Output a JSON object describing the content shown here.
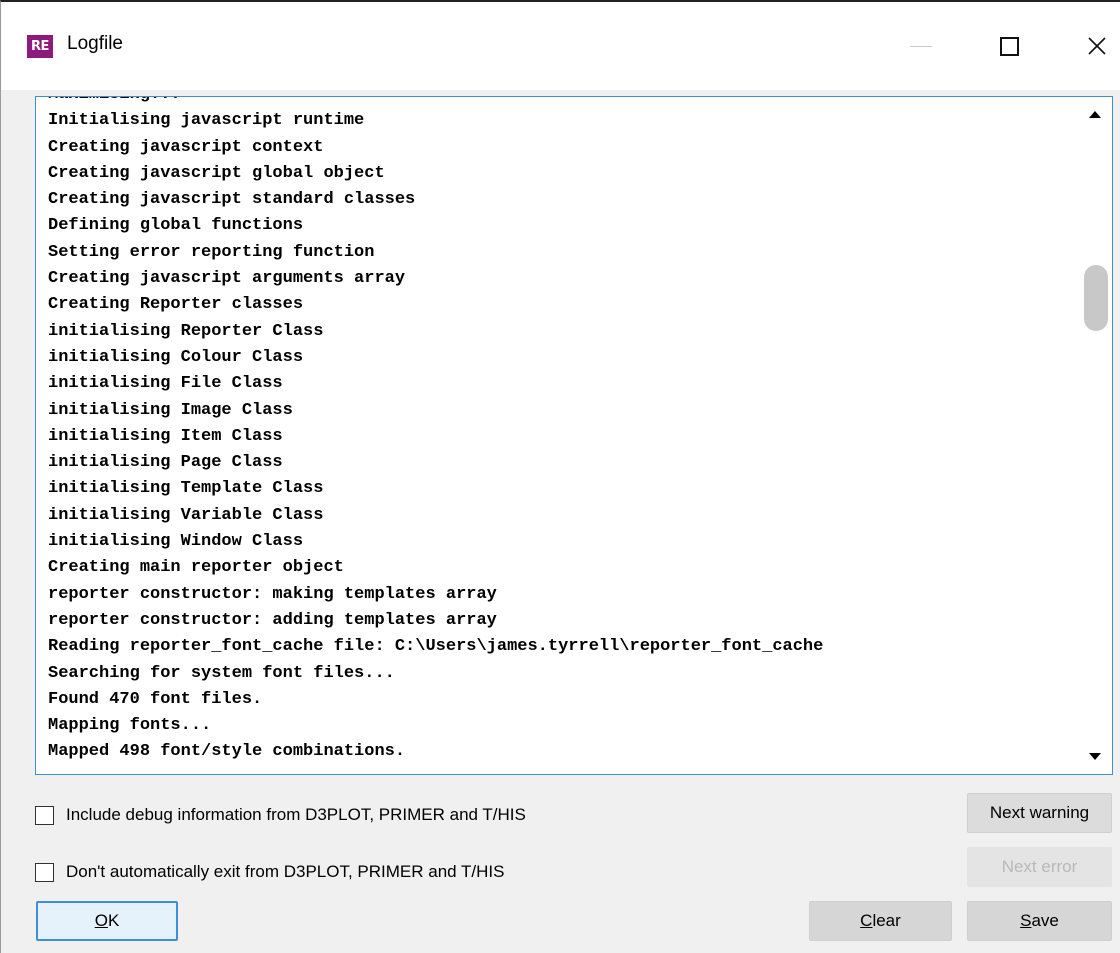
{
  "window": {
    "title": "Logfile",
    "icon_text": "RE",
    "icon_color": "#8e1a7e",
    "controls": [
      "minimize-icon",
      "maximize-icon",
      "close-icon"
    ]
  },
  "log": {
    "text": "Maximising...\nInitialising javascript runtime\nCreating javascript context\nCreating javascript global object\nCreating javascript standard classes\nDefining global functions\nSetting error reporting function\nCreating javascript arguments array\nCreating Reporter classes\ninitialising Reporter Class\ninitialising Colour Class\ninitialising File Class\ninitialising Image Class\ninitialising Item Class\ninitialising Page Class\ninitialising Template Class\ninitialising Variable Class\ninitialising Window Class\nCreating main reporter object\nreporter constructor: making templates array\nreporter constructor: adding templates array\nReading reporter_font_cache file: C:\\Users\\james.tyrrell\\reporter_font_cache\nSearching for system font files...\nFound 470 font files.\nMapping fonts...\nMapped 498 font/style combinations."
  },
  "options": {
    "include_debug_label": "Include debug information from D3PLOT, PRIMER and T/HIS",
    "include_debug_checked": false,
    "no_auto_exit_label": "Don't automatically exit from D3PLOT, PRIMER and T/HIS",
    "no_auto_exit_checked": false
  },
  "buttons": {
    "next_warning": "Next warning",
    "next_error": "Next error",
    "ok_mnemonic": "O",
    "ok_rest": "K",
    "clear_mnemonic": "C",
    "clear_rest": "lear",
    "save_mnemonic": "S",
    "save_rest": "ave"
  },
  "colors": {
    "focus_border": "#3f8fd6",
    "disabled_text": "#b8b8b8"
  }
}
